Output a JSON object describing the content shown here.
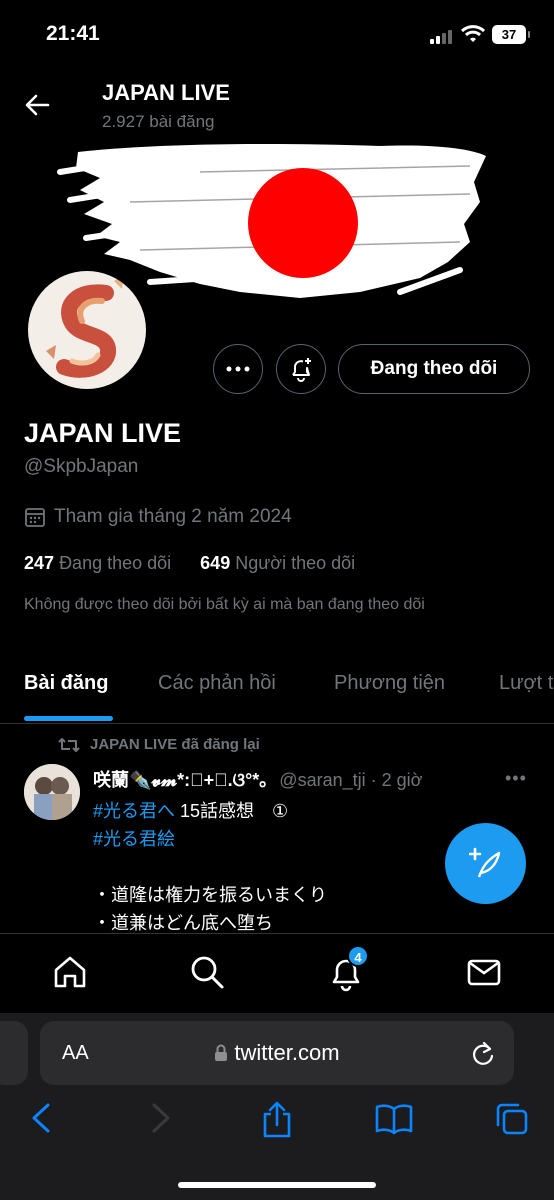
{
  "status_bar": {
    "time": "21:41",
    "battery": "37"
  },
  "header": {
    "title": "JAPAN LIVE",
    "post_count": "2.927 bài đăng"
  },
  "profile": {
    "name": "JAPAN LIVE",
    "handle": "@SkpbJapan",
    "joined": "Tham gia tháng 2 năm 2024",
    "following_count": "247",
    "following_label": "Đang theo dõi",
    "followers_count": "649",
    "followers_label": "Người theo dõi",
    "not_followed_note": "Không được theo dõi bởi bất kỳ ai mà bạn đang theo dõi",
    "follow_button_label": "Đang theo dõi"
  },
  "tabs": [
    {
      "label": "Bài đăng",
      "active": true
    },
    {
      "label": "Các phản hồi",
      "active": false
    },
    {
      "label": "Phương tiện",
      "active": false
    },
    {
      "label": "Lượt t",
      "active": false
    }
  ],
  "tweet": {
    "repost_label": "JAPAN LIVE đã đăng lại",
    "author": "咲蘭✒️𝓿𝓶*:゚+｡.ଓ°*｡",
    "handle_time": "@saran_tji · 2 giờ",
    "line1_hashtag": "#光る君へ",
    "line1_text": " 15話感想　①",
    "line2_hashtag": "#光る君絵",
    "line3": "・道隆は権力を振るいまくり",
    "line4": "・道兼はどん底へ堕ち"
  },
  "bottom_nav": {
    "notification_badge": "4"
  },
  "browser": {
    "aa_label": "AA",
    "url": "twitter.com"
  },
  "colors": {
    "accent": "#1d9bf0",
    "background": "#000000",
    "secondary_text": "#71767b"
  }
}
